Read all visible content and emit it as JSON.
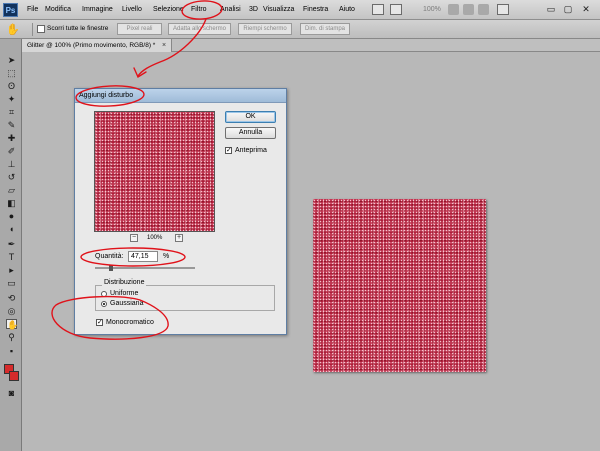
{
  "app": {
    "logo": "Ps"
  },
  "menu": [
    "File",
    "Modifica",
    "Immagine",
    "Livello",
    "Selezione",
    "Filtro",
    "Analisi",
    "3D",
    "Visualizza",
    "Finestra",
    "Aiuto"
  ],
  "menubar_right": {
    "zoom": "100%"
  },
  "options_bar": {
    "scroll_all_label": "Scorri tutte le finestre",
    "actual_pixels": "Pixel reali",
    "fit_screen": "Adatta allo schermo",
    "fill_screen": "Riempi schermo",
    "print_size": "Dim. di stampa"
  },
  "document_tab": {
    "title": "Glitter @ 100% (Primo movimento, RGB/8) *",
    "close": "×"
  },
  "dialog": {
    "title": "Aggiungi disturbo",
    "ok": "OK",
    "cancel": "Annulla",
    "preview_label": "Anteprima",
    "preview_checked": true,
    "zoom_out": "−",
    "zoom_in": "+",
    "zoom_pct": "100%",
    "amount_label": "Quantità:",
    "amount_value": "47,15",
    "amount_unit": "%",
    "amount_percent": 47.15,
    "distribution_title": "Distribuzione",
    "uniform_label": "Uniforme",
    "gaussian_label": "Gaussiana",
    "selected_distribution": "Gaussiana",
    "monochromatic_label": "Monocromatico",
    "monochromatic_checked": true
  },
  "colors": {
    "foreground": "#d62b2b",
    "background": "#d62b2b",
    "noise_base": "#b01e3a",
    "annotation": "#e0121a"
  }
}
